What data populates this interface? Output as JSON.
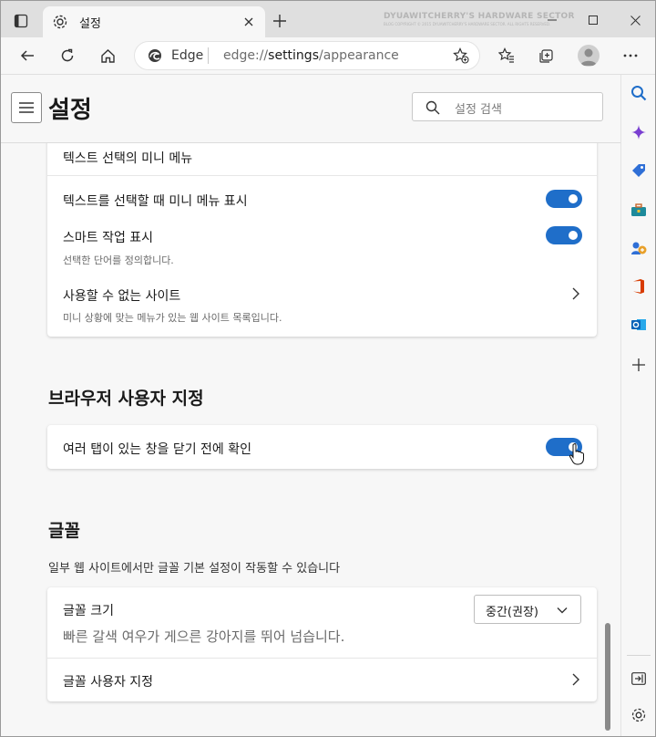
{
  "tab": {
    "title": "설정"
  },
  "watermark": {
    "main": "DYUAWITCHERRY'S HARDWARE SECTOR",
    "small": "BLOG COPYRIGHT © 2015 DYUAWITCHERRY'S HARDWARE SECTOR. ALL RIGHTS RESERVED."
  },
  "omnibox": {
    "brand": "Edge",
    "url_prefix": "edge://",
    "url_host": "settings",
    "url_path": "/appearance"
  },
  "header": {
    "title": "설정",
    "search_placeholder": "설정 검색"
  },
  "minimenu_card": {
    "heading": "텍스트 선택의 미니 메뉴",
    "show_label": "텍스트를 선택할 때 미니 메뉴 표시",
    "show_enabled": true,
    "smart_label": "스마트 작업 표시",
    "smart_sub": "선택한 단어를 정의합니다.",
    "smart_enabled": true,
    "blocked_label": "사용할 수 없는 사이트",
    "blocked_sub": "미니 상황에 맞는 메뉴가 있는 웹 사이트 목록입니다."
  },
  "browser_section": {
    "heading": "브라우저 사용자 지정",
    "confirm_label": "여러 탭이 있는 창을 닫기 전에 확인",
    "confirm_enabled": true
  },
  "font_section": {
    "heading": "글꼴",
    "desc": "일부 웹 사이트에서만 글꼴 기본 설정이 작동할 수 있습니다",
    "size_label": "글꼴 크기",
    "size_value": "중간(권장)",
    "preview_text": "빠른 갈색 여우가 게으른 강아지를 뛰어 넘습니다.",
    "customize_label": "글꼴 사용자 지정"
  },
  "colors": {
    "accent": "#1f6ec9",
    "background": "#f7f7f7"
  }
}
